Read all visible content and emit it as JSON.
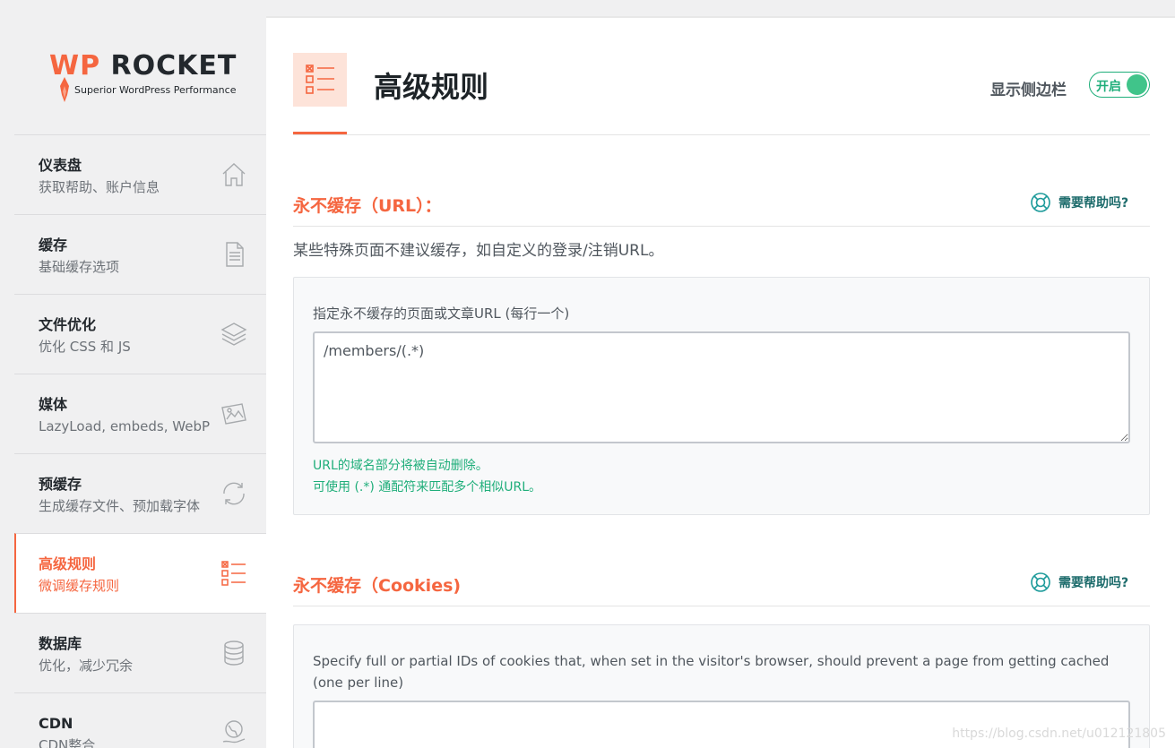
{
  "logo": {
    "brand_wp": "WP",
    "brand_rest": "ROCKET",
    "tagline": "Superior WordPress Performance"
  },
  "sidebar": {
    "items": [
      {
        "title": "仪表盘",
        "subtitle": "获取帮助、账户信息",
        "icon": "home-icon"
      },
      {
        "title": "缓存",
        "subtitle": "基础缓存选项",
        "icon": "file-icon"
      },
      {
        "title": "文件优化",
        "subtitle": "优化 CSS 和 JS",
        "icon": "layers-icon"
      },
      {
        "title": "媒体",
        "subtitle": "LazyLoad, embeds, WebP",
        "icon": "images-icon"
      },
      {
        "title": "预缓存",
        "subtitle": "生成缓存文件、预加载字体",
        "icon": "refresh-icon"
      },
      {
        "title": "高级规则",
        "subtitle": "微调缓存规则",
        "icon": "checklist-icon",
        "active": true
      },
      {
        "title": "数据库",
        "subtitle": "优化，减少冗余",
        "icon": "database-icon"
      },
      {
        "title": "CDN",
        "subtitle": "CDN整合",
        "icon": "globe-hand-icon"
      }
    ]
  },
  "header": {
    "title": "高级规则",
    "sidebar_toggle_label": "显示侧边栏",
    "toggle_text": "开启"
  },
  "sections": {
    "never_cache_urls": {
      "title": "永不缓存（URL）：",
      "help": "需要帮助吗?",
      "description": "某些特殊页面不建议缓存，如自定义的登录/注销URL。",
      "field_label": "指定永不缓存的页面或文章URL (每行一个)",
      "field_value": "/members/(.*)",
      "hint1": "URL的域名部分将被自动删除。",
      "hint2": "可使用 (.*) 通配符来匹配多个相似URL。"
    },
    "never_cache_cookies": {
      "title": "永不缓存（Cookies)",
      "help": "需要帮助吗?",
      "field_label": "Specify full or partial IDs of cookies that, when set in the visitor's browser, should prevent a page from getting cached (one per line)",
      "field_value": ""
    }
  },
  "watermark": "https://blog.csdn.net/u012121805",
  "colors": {
    "accent": "#f56640",
    "green": "#1fae7a",
    "help": "#1c6b6b"
  }
}
